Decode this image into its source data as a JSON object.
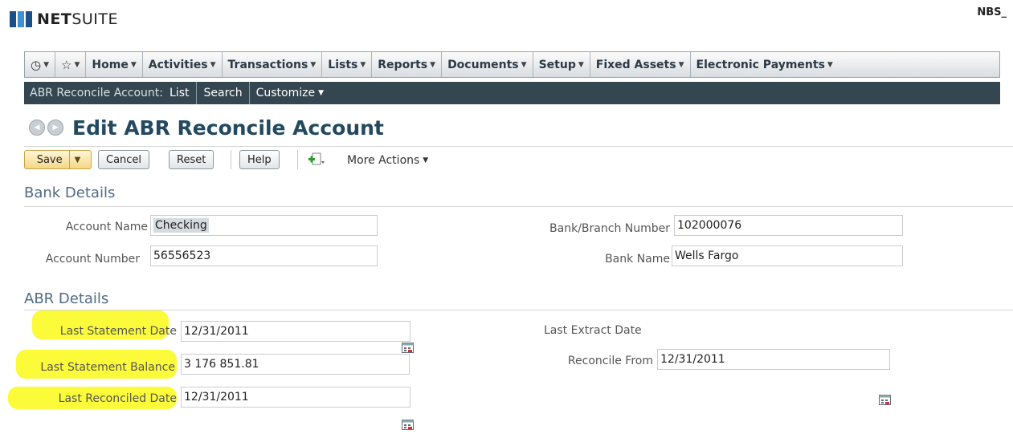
{
  "header": {
    "logo_text_bold": "NET",
    "logo_text_rest": "SUITE",
    "user_label": "NBS_"
  },
  "nav": {
    "items": [
      {
        "label": "Home"
      },
      {
        "label": "Activities"
      },
      {
        "label": "Transactions"
      },
      {
        "label": "Lists"
      },
      {
        "label": "Reports"
      },
      {
        "label": "Documents"
      },
      {
        "label": "Setup"
      },
      {
        "label": "Fixed Assets"
      },
      {
        "label": "Electronic Payments"
      }
    ]
  },
  "subnav": {
    "record_label": "ABR Reconcile Account:",
    "list": "List",
    "search": "Search",
    "customize": "Customize"
  },
  "page": {
    "title": "Edit ABR Reconcile Account"
  },
  "toolbar": {
    "save": "Save",
    "cancel": "Cancel",
    "reset": "Reset",
    "help": "Help",
    "more_actions": "More Actions"
  },
  "bank_details": {
    "title": "Bank Details",
    "account_name_label": "Account Name",
    "account_name_value": "Checking",
    "account_number_label": "Account Number",
    "account_number_value": "56556523",
    "branch_number_label": "Bank/Branch Number",
    "branch_number_value": "102000076",
    "bank_name_label": "Bank Name",
    "bank_name_value": "Wells Fargo"
  },
  "abr_details": {
    "title": "ABR Details",
    "last_statement_date_label": "Last Statement Date",
    "last_statement_date_value": "12/31/2011",
    "last_statement_balance_label": "Last Statement Balance",
    "last_statement_balance_value": "3 176 851.81",
    "last_reconciled_date_label": "Last Reconciled Date",
    "last_reconciled_date_value": "12/31/2011",
    "last_extract_date_label": "Last Extract Date",
    "reconcile_from_label": "Reconcile From",
    "reconcile_from_value": "12/31/2011"
  },
  "colors": {
    "highlight": "#fbfb3a",
    "subnav_bg": "#34464f",
    "title": "#22495f",
    "section_title": "#4f6c86"
  }
}
